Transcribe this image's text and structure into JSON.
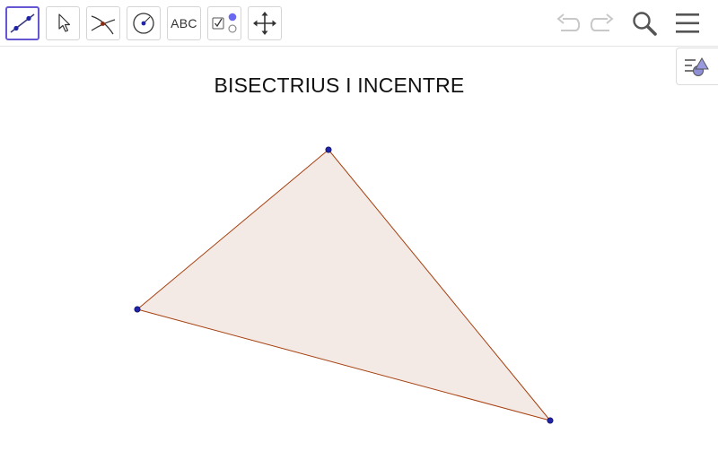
{
  "toolbar": {
    "tools": [
      {
        "name": "line",
        "icon": "line-through-two-points-icon",
        "active": true
      },
      {
        "name": "move",
        "icon": "cursor-arrow-icon",
        "active": false
      },
      {
        "name": "intersect",
        "icon": "intersect-icon",
        "active": false
      },
      {
        "name": "circle",
        "icon": "circle-with-center-icon",
        "active": false
      },
      {
        "name": "text",
        "label": "ABC",
        "icon": "text-icon",
        "active": false
      },
      {
        "name": "checkbox",
        "icon": "checkbox-icon",
        "active": false
      },
      {
        "name": "move-graphics",
        "icon": "move-arrows-icon",
        "active": false
      }
    ],
    "right": {
      "undo_icon": "undo-icon",
      "redo_icon": "redo-icon",
      "search_icon": "search-icon",
      "menu_icon": "menu-icon"
    }
  },
  "sidebar_toggle": {
    "icon": "algebra-view-icon"
  },
  "canvas": {
    "title": "BISECTRIUS I INCENTRE",
    "colors": {
      "fill": "#f3e9e5",
      "edge": "#a64010",
      "point": "#1f24a8",
      "accent": "#6557d2"
    }
  }
}
